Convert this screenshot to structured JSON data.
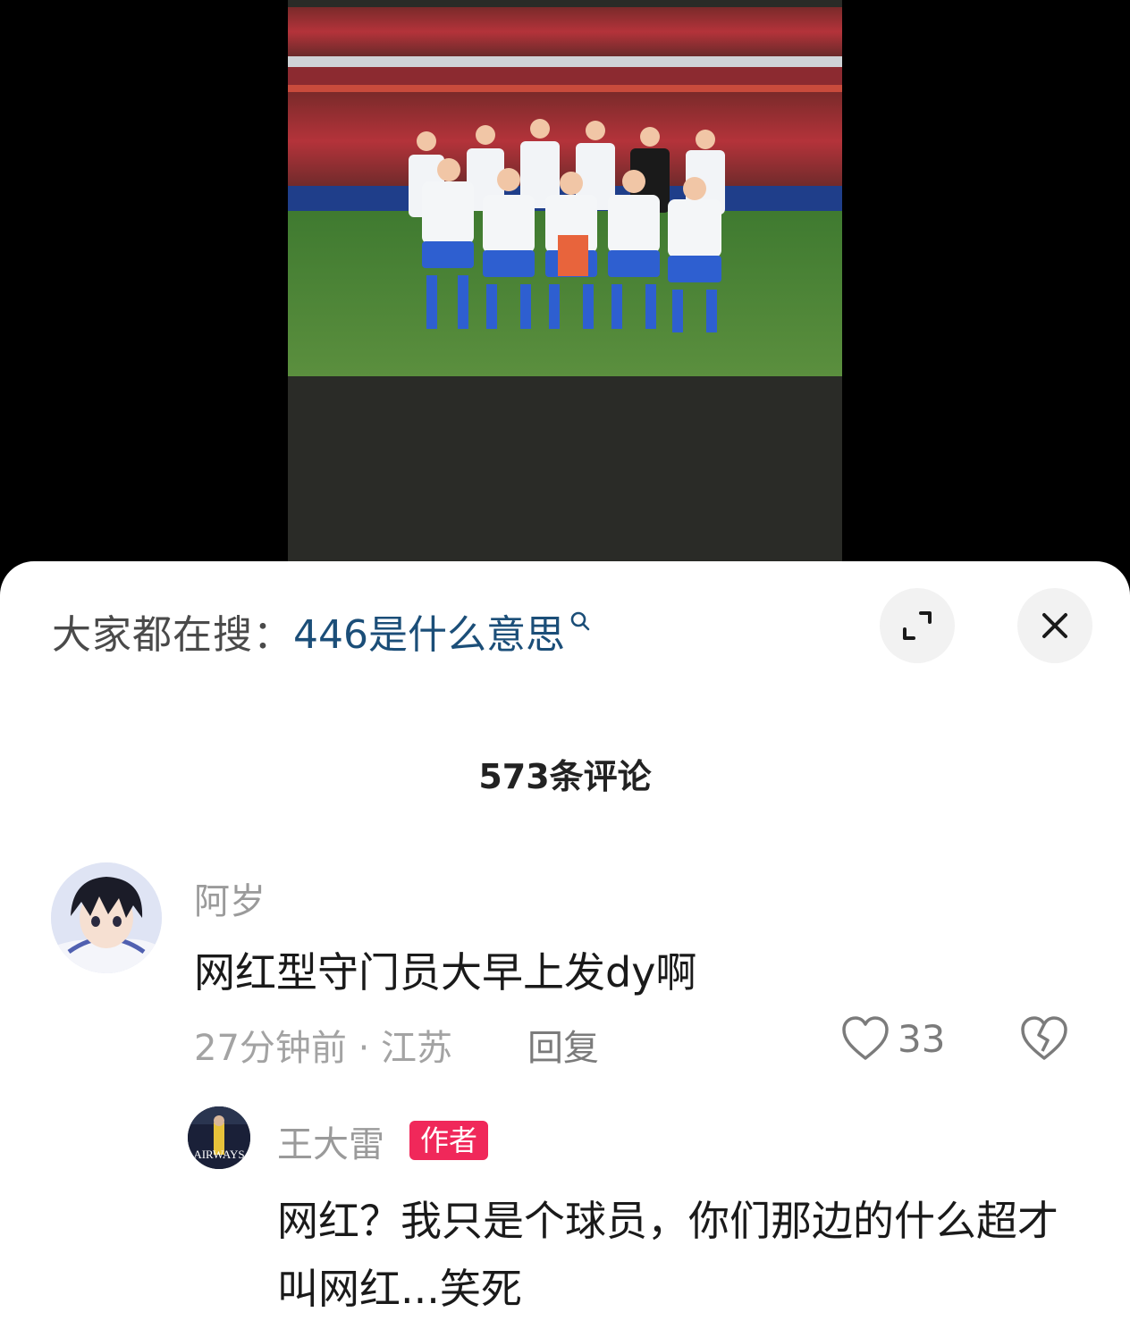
{
  "media": {
    "description_icon": "team-photo-image"
  },
  "sheet": {
    "search_prefix": "大家都在搜：",
    "search_term": "446是什么意思",
    "comment_count": "573条评论",
    "icons": {
      "expand": "expand-icon",
      "close": "close-icon",
      "search": "search-icon"
    }
  },
  "comments": [
    {
      "user": "阿岁",
      "text": "网红型守门员大早上发dy啊",
      "meta": "27分钟前 · 江苏",
      "reply_label": "回复",
      "likes": "33"
    }
  ],
  "reply": {
    "user": "王大雷",
    "badge": "作者",
    "text": "网红？我只是个球员，你们那边的什么超才叫网红...笑死",
    "avatar_text": "AIRWAYS"
  },
  "colors": {
    "link": "#1b4e78",
    "badge": "#f0285a"
  }
}
